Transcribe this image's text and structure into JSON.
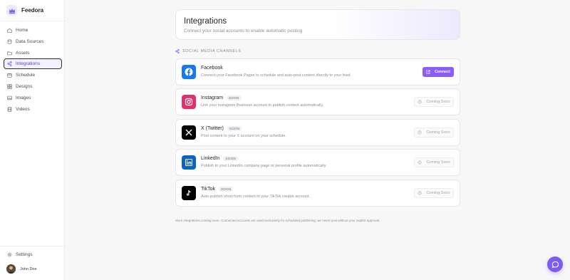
{
  "app": {
    "name": "Feedora",
    "logo_icon": "crown-logo-icon",
    "accent": "#8b5cf6"
  },
  "sidebar": {
    "items": [
      {
        "label": "Home",
        "icon": "home-icon"
      },
      {
        "label": "Data Sources",
        "icon": "database-icon"
      },
      {
        "label": "Assets",
        "icon": "folder-icon"
      },
      {
        "label": "Integrations",
        "icon": "share-icon",
        "active": true
      },
      {
        "label": "Schedule",
        "icon": "calendar-icon"
      },
      {
        "label": "Designs",
        "icon": "grid-icon"
      },
      {
        "label": "Images",
        "icon": "image-icon"
      },
      {
        "label": "Videos",
        "icon": "film-icon"
      }
    ],
    "settings_label": "Settings",
    "user_name": "John Doe"
  },
  "header": {
    "title": "Integrations",
    "subtitle": "Connect your social accounts to enable automatic posting"
  },
  "section": {
    "label": "SOCIAL MEDIA CHANNELS"
  },
  "integrations": [
    {
      "name": "Facebook",
      "badge": "",
      "description": "Connect your Facebook Pages to schedule and auto-post content directly to your feed.",
      "action": "Connect",
      "icon_color": "#1877f2"
    },
    {
      "name": "Instagram",
      "badge": "SOON",
      "description": "Link your Instagram Business account to publish content automatically.",
      "action": "Coming Soon",
      "icon_color": "#e1306c"
    },
    {
      "name": "X (Twitter)",
      "badge": "SOON",
      "description": "Post content to your X account on your schedule.",
      "action": "Coming Soon",
      "icon_color": "#000000"
    },
    {
      "name": "LinkedIn",
      "badge": "SOON",
      "description": "Publish to your LinkedIn company page or personal profile automatically.",
      "action": "Coming Soon",
      "icon_color": "#0a66c2"
    },
    {
      "name": "TikTok",
      "badge": "SOON",
      "description": "Auto-publish short-form content to your TikTok creator account.",
      "action": "Coming Soon",
      "icon_color": "#000000"
    }
  ],
  "footer_note": "More integrations coming soon. Connected accounts are used exclusively for scheduled publishing; we never post without your explicit approval.",
  "chat": {
    "icon": "chat-bubble-icon"
  }
}
